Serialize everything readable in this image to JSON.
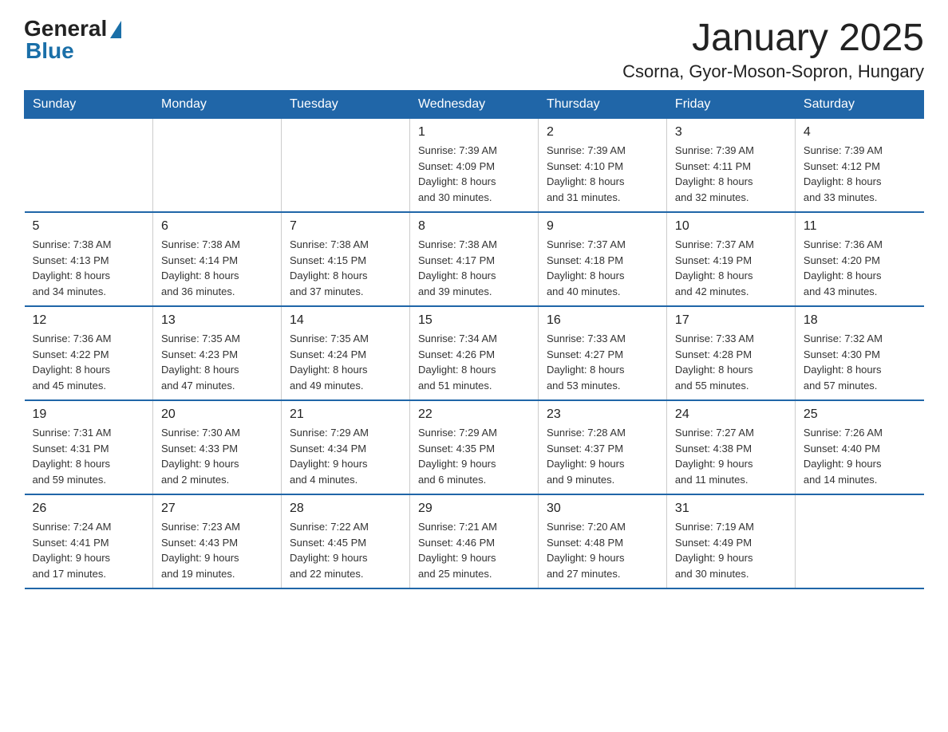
{
  "logo": {
    "general": "General",
    "blue": "Blue"
  },
  "title": "January 2025",
  "subtitle": "Csorna, Gyor-Moson-Sopron, Hungary",
  "days_of_week": [
    "Sunday",
    "Monday",
    "Tuesday",
    "Wednesday",
    "Thursday",
    "Friday",
    "Saturday"
  ],
  "weeks": [
    [
      {
        "day": "",
        "info": ""
      },
      {
        "day": "",
        "info": ""
      },
      {
        "day": "",
        "info": ""
      },
      {
        "day": "1",
        "info": "Sunrise: 7:39 AM\nSunset: 4:09 PM\nDaylight: 8 hours\nand 30 minutes."
      },
      {
        "day": "2",
        "info": "Sunrise: 7:39 AM\nSunset: 4:10 PM\nDaylight: 8 hours\nand 31 minutes."
      },
      {
        "day": "3",
        "info": "Sunrise: 7:39 AM\nSunset: 4:11 PM\nDaylight: 8 hours\nand 32 minutes."
      },
      {
        "day": "4",
        "info": "Sunrise: 7:39 AM\nSunset: 4:12 PM\nDaylight: 8 hours\nand 33 minutes."
      }
    ],
    [
      {
        "day": "5",
        "info": "Sunrise: 7:38 AM\nSunset: 4:13 PM\nDaylight: 8 hours\nand 34 minutes."
      },
      {
        "day": "6",
        "info": "Sunrise: 7:38 AM\nSunset: 4:14 PM\nDaylight: 8 hours\nand 36 minutes."
      },
      {
        "day": "7",
        "info": "Sunrise: 7:38 AM\nSunset: 4:15 PM\nDaylight: 8 hours\nand 37 minutes."
      },
      {
        "day": "8",
        "info": "Sunrise: 7:38 AM\nSunset: 4:17 PM\nDaylight: 8 hours\nand 39 minutes."
      },
      {
        "day": "9",
        "info": "Sunrise: 7:37 AM\nSunset: 4:18 PM\nDaylight: 8 hours\nand 40 minutes."
      },
      {
        "day": "10",
        "info": "Sunrise: 7:37 AM\nSunset: 4:19 PM\nDaylight: 8 hours\nand 42 minutes."
      },
      {
        "day": "11",
        "info": "Sunrise: 7:36 AM\nSunset: 4:20 PM\nDaylight: 8 hours\nand 43 minutes."
      }
    ],
    [
      {
        "day": "12",
        "info": "Sunrise: 7:36 AM\nSunset: 4:22 PM\nDaylight: 8 hours\nand 45 minutes."
      },
      {
        "day": "13",
        "info": "Sunrise: 7:35 AM\nSunset: 4:23 PM\nDaylight: 8 hours\nand 47 minutes."
      },
      {
        "day": "14",
        "info": "Sunrise: 7:35 AM\nSunset: 4:24 PM\nDaylight: 8 hours\nand 49 minutes."
      },
      {
        "day": "15",
        "info": "Sunrise: 7:34 AM\nSunset: 4:26 PM\nDaylight: 8 hours\nand 51 minutes."
      },
      {
        "day": "16",
        "info": "Sunrise: 7:33 AM\nSunset: 4:27 PM\nDaylight: 8 hours\nand 53 minutes."
      },
      {
        "day": "17",
        "info": "Sunrise: 7:33 AM\nSunset: 4:28 PM\nDaylight: 8 hours\nand 55 minutes."
      },
      {
        "day": "18",
        "info": "Sunrise: 7:32 AM\nSunset: 4:30 PM\nDaylight: 8 hours\nand 57 minutes."
      }
    ],
    [
      {
        "day": "19",
        "info": "Sunrise: 7:31 AM\nSunset: 4:31 PM\nDaylight: 8 hours\nand 59 minutes."
      },
      {
        "day": "20",
        "info": "Sunrise: 7:30 AM\nSunset: 4:33 PM\nDaylight: 9 hours\nand 2 minutes."
      },
      {
        "day": "21",
        "info": "Sunrise: 7:29 AM\nSunset: 4:34 PM\nDaylight: 9 hours\nand 4 minutes."
      },
      {
        "day": "22",
        "info": "Sunrise: 7:29 AM\nSunset: 4:35 PM\nDaylight: 9 hours\nand 6 minutes."
      },
      {
        "day": "23",
        "info": "Sunrise: 7:28 AM\nSunset: 4:37 PM\nDaylight: 9 hours\nand 9 minutes."
      },
      {
        "day": "24",
        "info": "Sunrise: 7:27 AM\nSunset: 4:38 PM\nDaylight: 9 hours\nand 11 minutes."
      },
      {
        "day": "25",
        "info": "Sunrise: 7:26 AM\nSunset: 4:40 PM\nDaylight: 9 hours\nand 14 minutes."
      }
    ],
    [
      {
        "day": "26",
        "info": "Sunrise: 7:24 AM\nSunset: 4:41 PM\nDaylight: 9 hours\nand 17 minutes."
      },
      {
        "day": "27",
        "info": "Sunrise: 7:23 AM\nSunset: 4:43 PM\nDaylight: 9 hours\nand 19 minutes."
      },
      {
        "day": "28",
        "info": "Sunrise: 7:22 AM\nSunset: 4:45 PM\nDaylight: 9 hours\nand 22 minutes."
      },
      {
        "day": "29",
        "info": "Sunrise: 7:21 AM\nSunset: 4:46 PM\nDaylight: 9 hours\nand 25 minutes."
      },
      {
        "day": "30",
        "info": "Sunrise: 7:20 AM\nSunset: 4:48 PM\nDaylight: 9 hours\nand 27 minutes."
      },
      {
        "day": "31",
        "info": "Sunrise: 7:19 AM\nSunset: 4:49 PM\nDaylight: 9 hours\nand 30 minutes."
      },
      {
        "day": "",
        "info": ""
      }
    ]
  ]
}
